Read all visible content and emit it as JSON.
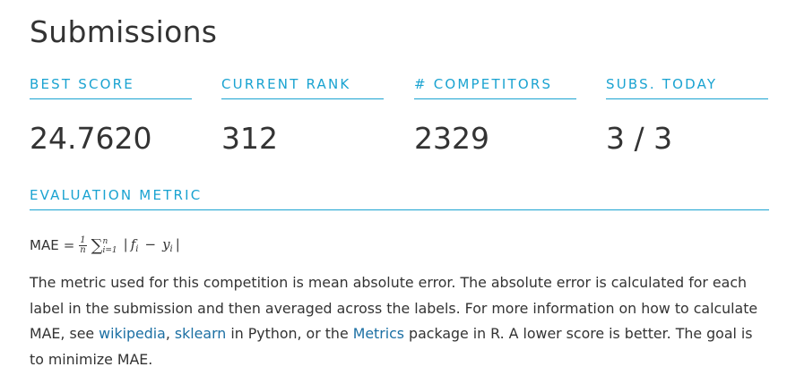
{
  "page": {
    "title": "Submissions"
  },
  "stats": [
    {
      "label": "BEST SCORE",
      "value": "24.7620"
    },
    {
      "label": "CURRENT RANK",
      "value": "312"
    },
    {
      "label": "# COMPETITORS",
      "value": "2329"
    },
    {
      "label": "SUBS. TODAY",
      "value": "3 / 3"
    }
  ],
  "evaluation": {
    "heading": "EVALUATION METRIC",
    "formula": {
      "lhs": "MAE",
      "equals": "=",
      "frac_num": "1",
      "frac_den": "n",
      "sum_symbol": "∑",
      "sum_upper": "n",
      "sum_lower": "i=1",
      "abs_open": "|",
      "f": "f",
      "f_sub": "i",
      "minus": "−",
      "y": "y",
      "y_sub": "i",
      "abs_close": "|"
    },
    "description": {
      "text1": "The metric used for this competition is mean absolute error. The absolute error is calculated for each label in the submission and then averaged across the labels. For more information on how to calculate MAE, see ",
      "link1": "wikipedia",
      "text2": ", ",
      "link2": "sklearn",
      "text3": " in Python, or the ",
      "link3": "Metrics",
      "text4": " package in R. A lower score is better. The goal is to minimize MAE."
    }
  },
  "colors": {
    "accent": "#1aa3d1",
    "link": "#1b6fa3",
    "text": "#333333"
  }
}
